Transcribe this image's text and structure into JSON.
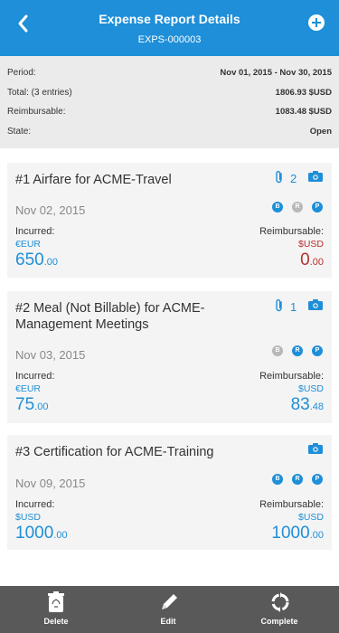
{
  "header": {
    "title": "Expense Report Details",
    "report_id": "EXPS-000003"
  },
  "summary": {
    "period_label": "Period:",
    "period_value": "Nov 01, 2015 - Nov 30, 2015",
    "total_label": "Total: (3 entries)",
    "total_value": "1806.93 $USD",
    "reimbursable_label": "Reimbursable:",
    "reimbursable_value": "1083.48 $USD",
    "state_label": "State:",
    "state_value": "Open"
  },
  "entries": [
    {
      "title": "#1 Airfare for ACME-Travel",
      "date": "Nov 02, 2015",
      "attachments": "2",
      "badges": [
        "B",
        "R",
        "P"
      ],
      "badge_states": [
        "active",
        "inactive",
        "active"
      ],
      "incurred_label": "Incurred:",
      "incurred_currency": "€EUR",
      "incurred_main": "650",
      "incurred_dec": ".00",
      "reimbursable_label": "Reimbursable:",
      "reimbursable_currency": "$USD",
      "reimbursable_main": "0",
      "reimbursable_dec": ".00",
      "reimbursable_color": "#B7312C"
    },
    {
      "title_line1": "#2 Meal (Not Billable) for ACME-",
      "title_line2": "Management Meetings",
      "date": "Nov 03, 2015",
      "attachments": "1",
      "badges": [
        "B",
        "R",
        "P"
      ],
      "badge_states": [
        "inactive",
        "active",
        "active"
      ],
      "incurred_label": "Incurred:",
      "incurred_currency": "€EUR",
      "incurred_main": "75",
      "incurred_dec": ".00",
      "reimbursable_label": "Reimbursable:",
      "reimbursable_currency": "$USD",
      "reimbursable_main": "83",
      "reimbursable_dec": ".48"
    },
    {
      "title": "#3 Certification for ACME-Training",
      "date": "Nov 09, 2015",
      "badges": [
        "B",
        "R",
        "P"
      ],
      "badge_states": [
        "active",
        "active",
        "active"
      ],
      "incurred_label": "Incurred:",
      "incurred_currency": "$USD",
      "incurred_main": "1000",
      "incurred_dec": ".00",
      "reimbursable_label": "Reimbursable:",
      "reimbursable_currency": "$USD",
      "reimbursable_main": "1000",
      "reimbursable_dec": ".00"
    }
  ],
  "toolbar": {
    "delete_label": "Delete",
    "edit_label": "Edit",
    "complete_label": "Complete"
  },
  "colors": {
    "accent": "#1E8FD8",
    "negative": "#B7312C",
    "badge_inactive": "#B8B8B8",
    "toolbar": "#595959"
  },
  "icons": [
    "back-chevron-icon",
    "add-circle-icon",
    "paperclip-icon",
    "camera-icon",
    "trash-icon",
    "pencil-icon",
    "complete-cycle-icon"
  ]
}
